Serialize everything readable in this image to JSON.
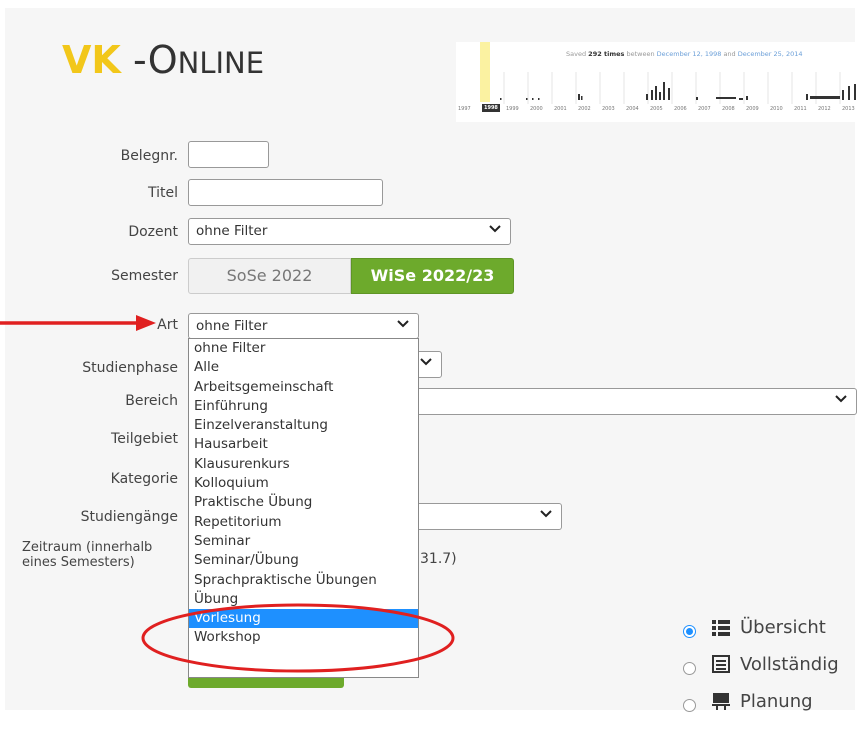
{
  "logo": {
    "vk": "VK",
    "dash": "-",
    "o_big": "O",
    "nline": "NLINE"
  },
  "wayback": {
    "caption_prefix": "Saved",
    "caption_count": "292 times",
    "caption_between": "between",
    "caption_from": "December 12, 1998",
    "caption_and": "and",
    "caption_to": "December 25, 2014",
    "years": [
      "1997",
      "1998",
      "1999",
      "2000",
      "2001",
      "2002",
      "2003",
      "2004",
      "2005",
      "2006",
      "2007",
      "2008",
      "2009",
      "2010",
      "2011",
      "2012",
      "2013"
    ],
    "selected_year": "1998"
  },
  "form": {
    "belegnr_label": "Belegnr.",
    "titel_label": "Titel",
    "dozent_label": "Dozent",
    "dozent_value": "ohne Filter",
    "semester_label": "Semester",
    "semester_options": [
      "SoSe 2022",
      "WiSe 2022/23"
    ],
    "semester_selected": "WiSe 2022/23",
    "art_label": "Art",
    "art_value": "ohne Filter",
    "studienphase_label": "Studienphase",
    "bereich_label": "Bereich",
    "teilgebiet_label": "Teilgebiet",
    "kategorie_label": "Kategorie",
    "studiengaenge_label": "Studiengänge",
    "zeitraum_label_1": "Zeitraum (innerhalb",
    "zeitraum_label_2": "eines Semesters)",
    "zeitraum_hint": "31.7)"
  },
  "art_dropdown": {
    "options": [
      "ohne Filter",
      "Alle",
      "Arbeitsgemeinschaft",
      "Einführung",
      "Einzelveranstaltung",
      "Hausarbeit",
      "Klausurenkurs",
      "Kolloquium",
      "Praktische Übung",
      "Repetitorium",
      "Seminar",
      "Seminar/Übung",
      "Sprachpraktische Übungen",
      "Übung",
      "Vorlesung",
      "Workshop"
    ],
    "highlighted": "Vorlesung"
  },
  "views": [
    {
      "label": "Übersicht",
      "icon": "list-icon",
      "checked": true
    },
    {
      "label": "Vollständig",
      "icon": "document-icon",
      "checked": false
    },
    {
      "label": "Planung",
      "icon": "presentation-icon",
      "checked": false
    }
  ],
  "colors": {
    "accent_green": "#6daa2c",
    "logo_yellow": "#f2c71a",
    "selection_blue": "#1e90ff",
    "annotation_red": "#e02020"
  }
}
